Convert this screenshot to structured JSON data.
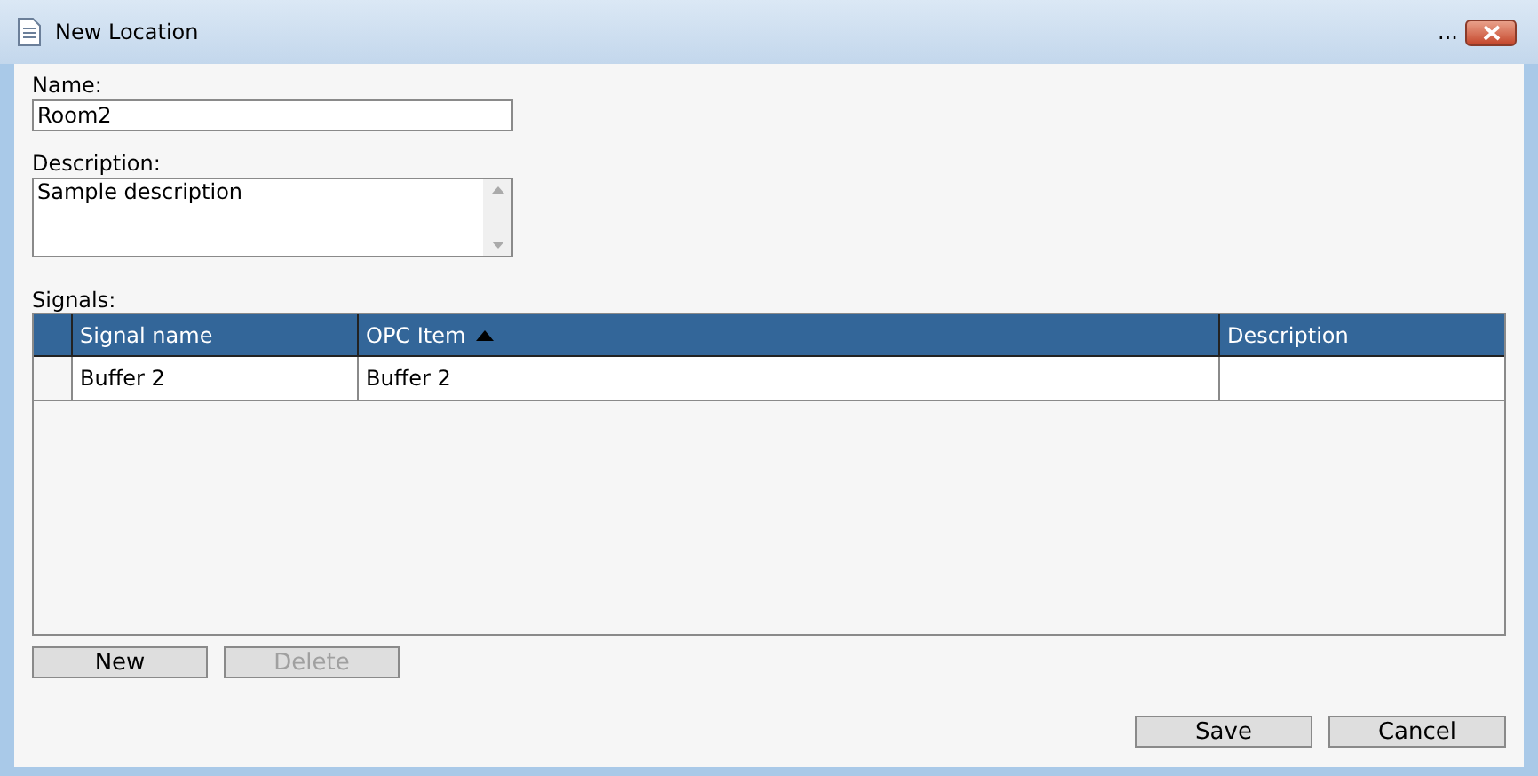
{
  "window": {
    "title": "New Location",
    "extra": "..."
  },
  "name_field": {
    "label": "Name:",
    "value": "Room2"
  },
  "description_field": {
    "label": "Description:",
    "value": "Sample description"
  },
  "signals": {
    "label": "Signals:",
    "columns": [
      {
        "label": "Signal name",
        "sorted": false
      },
      {
        "label": "OPC Item",
        "sorted": true
      },
      {
        "label": "Description",
        "sorted": false
      }
    ],
    "rows": [
      {
        "cells": [
          "Buffer 2",
          "Buffer 2",
          null
        ]
      }
    ]
  },
  "grid_buttons": [
    {
      "label": "New",
      "disabled": false
    },
    {
      "label": "Delete",
      "disabled": true
    }
  ],
  "dialog_buttons": [
    {
      "label": "Save",
      "disabled": false
    },
    {
      "label": "Cancel",
      "disabled": false
    }
  ]
}
